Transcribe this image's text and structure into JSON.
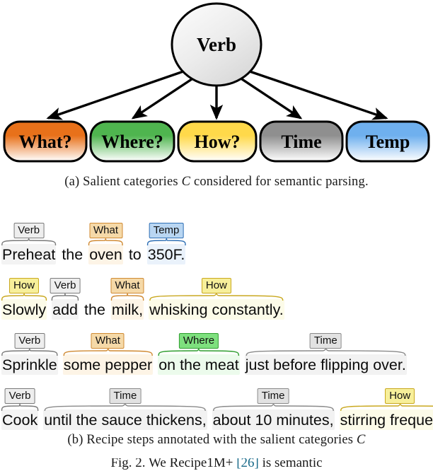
{
  "figure": {
    "root_node": {
      "label": "Verb"
    },
    "categories": [
      {
        "label": "What?",
        "color": "#e8711a",
        "text_color": "#0d0d0d"
      },
      {
        "label": "Where?",
        "color": "#4fb54f",
        "text_color": "#0d0d0d"
      },
      {
        "label": "How?",
        "color": "#ffd94a",
        "text_color": "#0d0d0d"
      },
      {
        "label": "Time",
        "color": "#8f8f8f",
        "text_color": "#0d0d0d"
      },
      {
        "label": "Temp",
        "color": "#6fb0ee",
        "text_color": "#0d0d0d"
      }
    ],
    "caption_a": "(a) Salient categories C considered for semantic parsing.",
    "caption_a_pre": "(a) Salient categories ",
    "caption_a_cal": "C",
    "caption_a_post": " considered for semantic parsing.",
    "caption_b_pre": "(b) Recipe steps annotated with the salient categories ",
    "caption_b_cal": "C",
    "caption_b_post": "",
    "tail_pre": "Fig. 2.  We ",
    "tail_mid": "Recipe1M+ ",
    "tail_ref": "[26]",
    "tail_post": " is  semantic"
  },
  "tag_styles": {
    "Verb": {
      "bg": "#eeeeee",
      "border": "#7a7a7a",
      "text": "#111111",
      "highlight": "#f3f3f3"
    },
    "What": {
      "bg": "#f5d9a8",
      "border": "#d08a33",
      "text": "#111111",
      "highlight": "#fdf4e6"
    },
    "Where": {
      "bg": "#7ee07e",
      "border": "#2f9e2f",
      "text": "#111111",
      "highlight": "#ecfbec"
    },
    "How": {
      "bg": "#f7ef9a",
      "border": "#c9a81f",
      "text": "#111111",
      "highlight": "#fcfbe8"
    },
    "Time": {
      "bg": "#e2e2e2",
      "border": "#8a8a8a",
      "text": "#111111",
      "highlight": "#f2f2f2"
    },
    "Temp": {
      "bg": "#b9d6f2",
      "border": "#2e6fb5",
      "text": "#111111",
      "highlight": "#eaf2fb"
    }
  },
  "sentences": [
    {
      "id": "sentence-preheat",
      "segments": [
        {
          "text": "Preheat",
          "tag": "Verb"
        },
        {
          "text": "the",
          "tag": null
        },
        {
          "text": "oven",
          "tag": "What"
        },
        {
          "text": "to",
          "tag": null
        },
        {
          "text": "350F.",
          "tag": "Temp"
        }
      ]
    },
    {
      "id": "sentence-slowly",
      "segments": [
        {
          "text": "Slowly",
          "tag": "How"
        },
        {
          "text": "add",
          "tag": "Verb"
        },
        {
          "text": "the",
          "tag": null
        },
        {
          "text": "milk,",
          "tag": "What"
        },
        {
          "text": "whisking constantly.",
          "tag": "How"
        }
      ]
    },
    {
      "id": "sentence-sprinkle",
      "segments": [
        {
          "text": "Sprinkle",
          "tag": "Verb"
        },
        {
          "text": "some pepper",
          "tag": "What"
        },
        {
          "text": "on the meat",
          "tag": "Where"
        },
        {
          "text": "just before flipping over.",
          "tag": "Time"
        }
      ]
    },
    {
      "id": "sentence-cook",
      "segments": [
        {
          "text": "Cook",
          "tag": "Verb"
        },
        {
          "text": "until the sauce thickens,",
          "tag": "Time"
        },
        {
          "text": "about 10 minutes,",
          "tag": "Time"
        },
        {
          "text": "stirring frequently.",
          "tag": "How"
        }
      ]
    }
  ]
}
